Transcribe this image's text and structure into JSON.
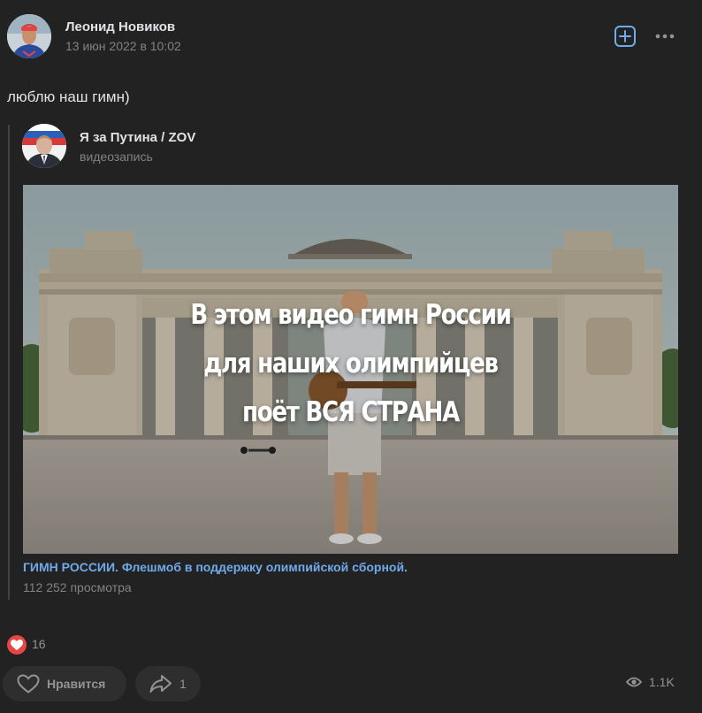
{
  "author": {
    "name": "Леонид Новиков",
    "date": "13 июн 2022 в 10:02"
  },
  "post": {
    "text": "люблю наш гимн)"
  },
  "repost": {
    "name": "Я за Путина / ZOV",
    "type": "видеозапись",
    "video": {
      "overlay_lines": [
        "В этом видео гимн России",
        "для наших олимпийцев",
        "поёт ВСЯ СТРАНА"
      ],
      "title": "ГИМН РОССИИ. Флешмоб в поддержку олимпийской сборной.",
      "views": "112 252 просмотра"
    }
  },
  "reactions": {
    "icon": "heart-icon",
    "count": "16"
  },
  "actions": {
    "like_label": "Нравится",
    "share_count": "1",
    "views_count": "1.1K"
  },
  "colors": {
    "background": "#222222",
    "link": "#71aaeb",
    "reaction": "#e64646",
    "muted": "#828282"
  }
}
